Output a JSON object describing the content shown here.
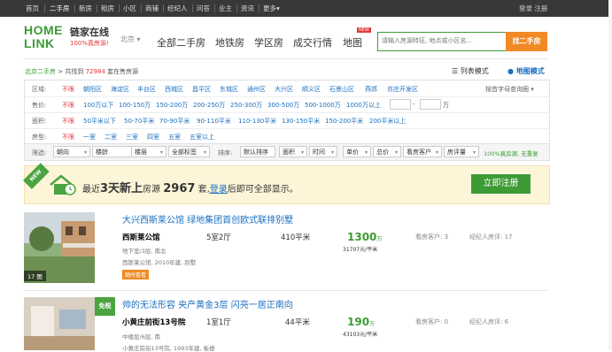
{
  "topnav": {
    "items": [
      "首页",
      "二手房",
      "新房",
      "租房",
      "小区",
      "商铺",
      "经纪人",
      "问答",
      "业主",
      "资讯",
      "更多▾"
    ],
    "right": "登录  注册"
  },
  "header": {
    "logo_top": "HOME",
    "logo_bottom": "LINK",
    "logo_cn": "链家在线",
    "logo_slogan": "100%真房源!",
    "city": "北京 ▾",
    "nav": [
      "全部二手房",
      "地铁房",
      "学区房",
      "成交行情",
      "地图"
    ],
    "new_badge": "NEW",
    "search_placeholder": "请输入房源特征, 地点或小区名...",
    "search_button": "找二手房"
  },
  "breadcrumb": {
    "home": "北京二手房",
    "sep": ">",
    "found_prefix": "共找到",
    "count": "72984",
    "found_suffix": "套在售房源"
  },
  "viewmode": {
    "list": "列表模式",
    "map": "地图模式"
  },
  "filters": {
    "area": {
      "label": "区域:",
      "options": [
        "不限",
        "朝阳区",
        "海淀区",
        "丰台区",
        "西城区",
        "昌平区",
        "东城区",
        "通州区",
        "大兴区",
        "顺义区",
        "石景山区",
        "燕郊",
        "亦庄开发区"
      ],
      "right": "按首字母查询圈 ▾"
    },
    "price": {
      "label": "售价:",
      "options": [
        "不限",
        "100万以下",
        "100-150万",
        "150-200万",
        "200-250万",
        "250-300万",
        "300-500万",
        "500-1000万",
        "1000万以上"
      ],
      "sep": "-",
      "unit": "万"
    },
    "size": {
      "label": "面积:",
      "options": [
        "不限",
        "50平米以下",
        "50-70平米",
        "70-90平米",
        "90-110平米",
        "110-130平米",
        "130-150平米",
        "150-200平米",
        "200平米以上"
      ]
    },
    "layout": {
      "label": "房型:",
      "options": [
        "不限",
        "一室",
        "二室",
        "三室",
        "四室",
        "五室",
        "五室以上"
      ]
    }
  },
  "sortbar": {
    "label": "筛选:",
    "dropdowns": [
      "朝向",
      "楼龄",
      "楼层",
      "全部标签"
    ],
    "sort_label": "排序:",
    "sorts": [
      "默认排序",
      "面积",
      "时间",
      "单价",
      "总价",
      "看房客户",
      "房评量"
    ],
    "note": "100%真房源, 无重复"
  },
  "banner": {
    "ribbon": "NEW",
    "pre": "最近",
    "days": "3天新上",
    "mid": "房源",
    "num": "2967",
    "unit": "套,",
    "login": "登录",
    "post": "后即可全部显示。",
    "button": "立即注册"
  },
  "listings": [
    {
      "title": "大兴西斯莱公馆 绿地集团首创欧式联排别墅",
      "name": "西斯莱公馆",
      "rooms": "5室2厅",
      "area": "410平米",
      "sub1": "地下室/3层, 南北",
      "sub2": "西斯莱公馆, 2010年建, 别墅",
      "tag": "随时看看",
      "price": "1300",
      "price_unit": "万",
      "unit_price": "31707元/平米",
      "viewers_label": "看房客户:",
      "viewers": "3",
      "reviews_label": "经纪人房评:",
      "reviews": "17",
      "photo_count": "17 图"
    },
    {
      "title": "帅的无法形容 央产黄金3层 闪亮一居正南向",
      "name": "小黄庄前街13号院",
      "rooms": "1室1厅",
      "area": "44平米",
      "sub1": "中楼层/6层, 南",
      "sub2": "小黄庄前街13号院, 1993年建, 板楼",
      "price": "190",
      "price_unit": "万",
      "unit_price": "43103元/平米",
      "viewers_label": "看房客户:",
      "viewers": "0",
      "reviews_label": "经纪人房评:",
      "reviews": "6",
      "free": "免税"
    }
  ]
}
